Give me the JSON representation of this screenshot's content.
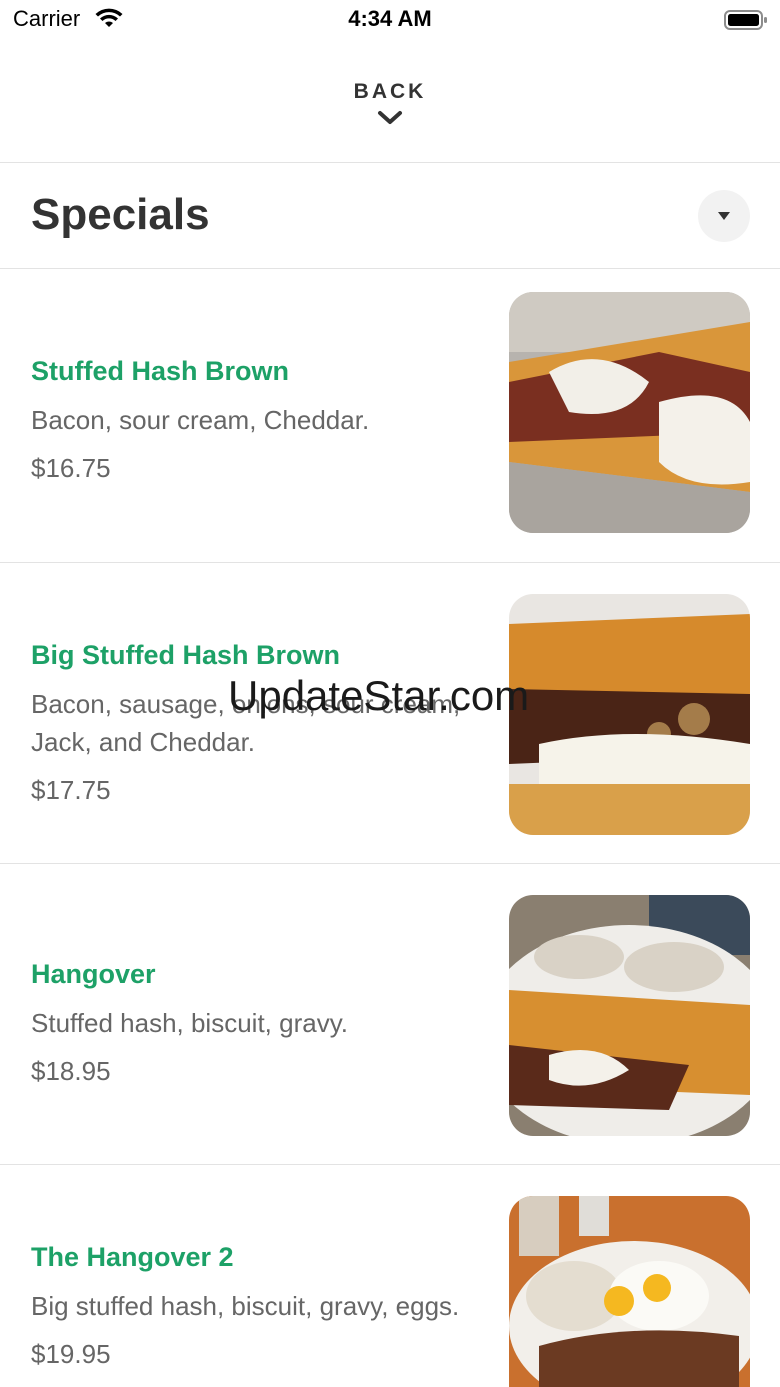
{
  "status_bar": {
    "carrier": "Carrier",
    "time": "4:34 AM"
  },
  "nav": {
    "back_label": "BACK"
  },
  "section": {
    "title": "Specials"
  },
  "items": [
    {
      "name": "Stuffed Hash Brown",
      "description": "Bacon, sour cream, Cheddar.",
      "price": "$16.75"
    },
    {
      "name": "Big Stuffed Hash Brown",
      "description": "Bacon, sausage, onions, sour cream, Jack, and Cheddar.",
      "price": "$17.75"
    },
    {
      "name": "Hangover",
      "description": "Stuffed hash, biscuit, gravy.",
      "price": "$18.95"
    },
    {
      "name": "The Hangover 2",
      "description": "Big stuffed hash, biscuit, gravy, eggs.",
      "price": "$19.95"
    }
  ],
  "watermark": "UpdateStar.com",
  "colors": {
    "item_name": "#1da167",
    "body_text": "#666666",
    "title_text": "#333333"
  }
}
